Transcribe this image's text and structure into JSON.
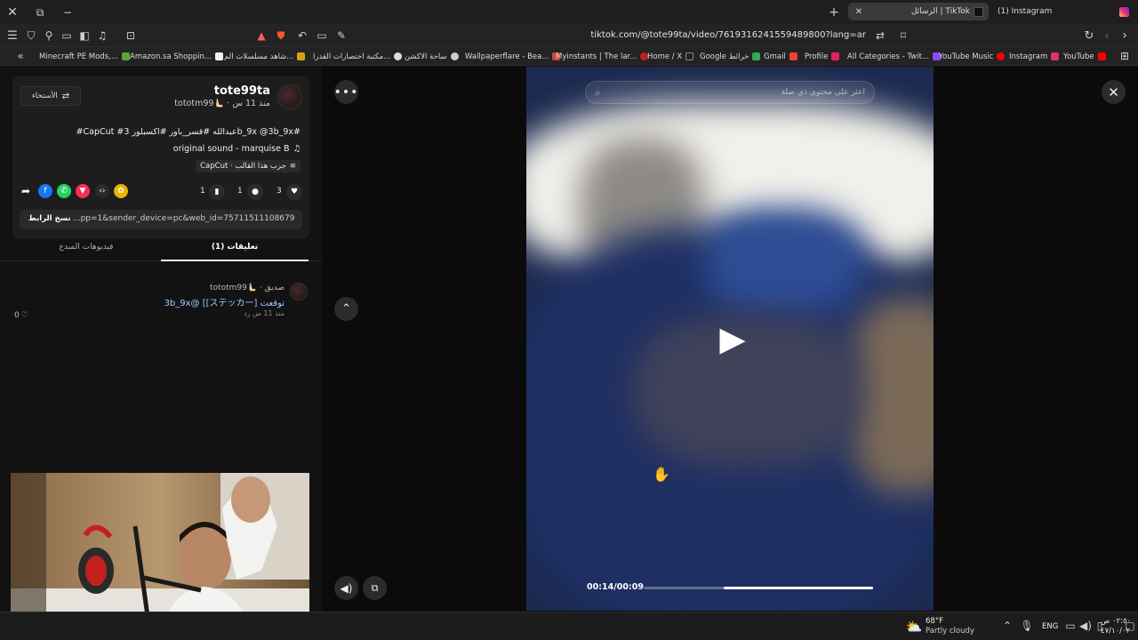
{
  "browser": {
    "tabs": [
      {
        "label": "(1) Instagram",
        "active": false
      },
      {
        "label": "الرسائل | TikTok",
        "active": true
      }
    ],
    "url": "tiktok.com/@tote99ta/video/7619316241559489800?lang=ar",
    "bookmarks": [
      {
        "label": "Minecraft PE Mods,...",
        "color": "#5aa53b"
      },
      {
        "label": "Amazon.sa Shoppin...",
        "color": "#f0f0f0"
      },
      {
        "label": "شاهد مسلسلات الم...",
        "color": "#d4a017"
      },
      {
        "label": "مكتبة اختصارات القدرا...",
        "color": "#dddddd"
      },
      {
        "label": "ساحة الاكشن",
        "color": "#cccccc"
      },
      {
        "label": "Wallpaperflare - Bea...",
        "color": "#c94a3a"
      },
      {
        "label": "Myinstants | The lar...",
        "color": "#c41e1e"
      },
      {
        "label": "Home / X",
        "color": "#222222"
      },
      {
        "label": "Google خرائط",
        "color": "#34a853"
      },
      {
        "label": "Gmail",
        "color": "#ea4335"
      },
      {
        "label": "Profile",
        "color": "#e0245e"
      },
      {
        "label": "All Categories - Twit...",
        "color": "#9146ff"
      },
      {
        "label": "YouTube Music",
        "color": "#ff0000"
      },
      {
        "label": "Instagram",
        "color": "#e1306c"
      },
      {
        "label": "YouTube",
        "color": "#ff0000"
      }
    ]
  },
  "post": {
    "username": "tote99ta",
    "display_meta": "tototm99🫷🏻 · منذ 11 س",
    "follow_label": "الأستخاء",
    "caption": "#CapCut #عبدالله #قسر_باور #اكسبلور 3b_9x @3b_9x#",
    "sound": "original sound - marquise B",
    "template": "CapCut · جرب هذا القالب",
    "likes": "3",
    "comments": "1",
    "saves": "1",
    "link_text": "...pp=1&sender_device=pc&web_id=7571151110867961356",
    "copy_label": "نسخ الرابط"
  },
  "tabs": {
    "comments": "(1) تعليقات",
    "creator_videos": "فيديوهات المبدع"
  },
  "comment": {
    "author": "tototm99🫷🏻 · صديق",
    "text": "3b_9x@ [[ステッカー] توقعت",
    "meta": "منذ 11 س   رد",
    "likes": "0"
  },
  "player": {
    "search_placeholder": "اعثر على محتوى ذي صلة",
    "time": "00:14/00:09",
    "progress": 0.65
  },
  "taskbar": {
    "temp": "68°F",
    "weather": "Partly cloudy",
    "lang": "ENG",
    "time": "٠٢:٥٠ ص",
    "date": "٤٧/١٠/٠٢"
  }
}
